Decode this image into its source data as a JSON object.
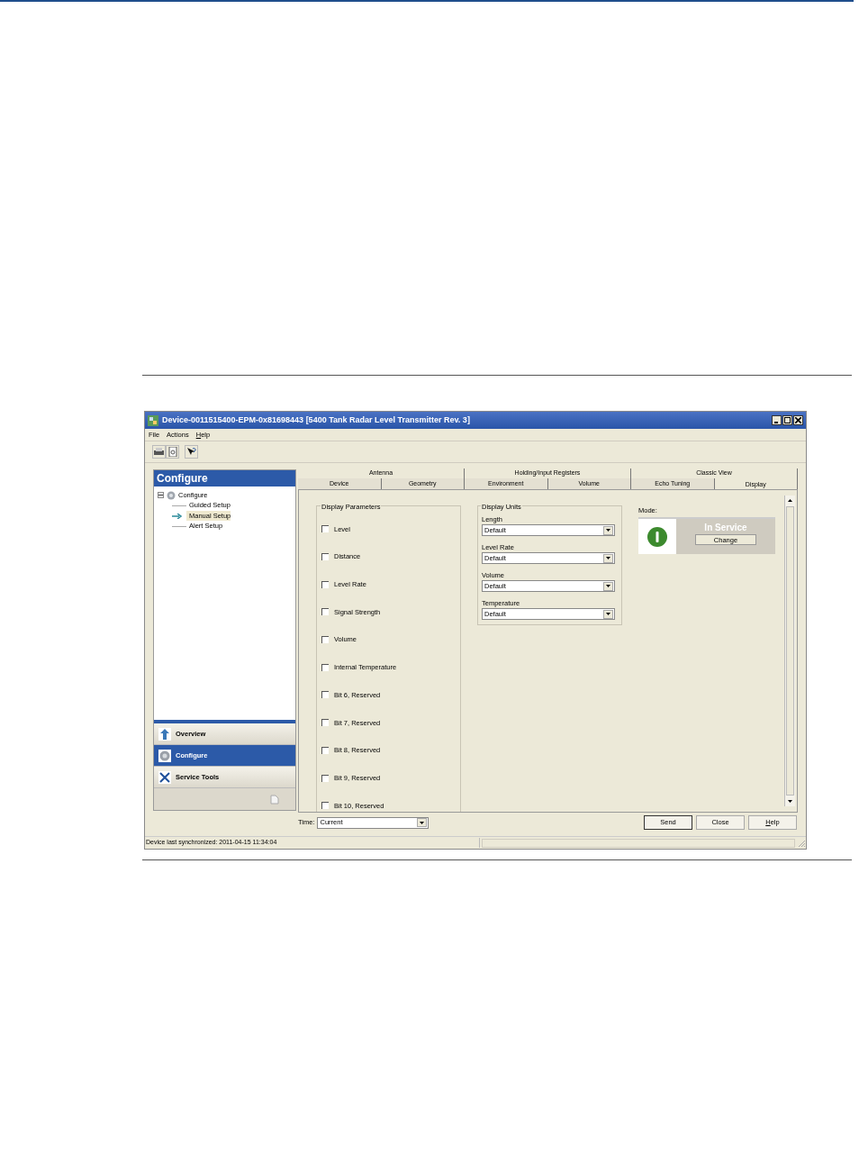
{
  "window": {
    "title": "Device-0011515400-EPM-0x81698443 [5400 Tank Radar Level Transmitter Rev. 3]"
  },
  "menu": [
    {
      "label": "File",
      "mnemonic": false
    },
    {
      "label": "Actions",
      "mnemonic": false
    },
    {
      "label": "Help",
      "mnemonic": true
    }
  ],
  "sidebar": {
    "header": "Configure",
    "tree": [
      {
        "label": "Configure",
        "expanded": true,
        "selected": false,
        "children": [
          {
            "label": "Guided Setup",
            "selected": false
          },
          {
            "label": "Manual Setup",
            "selected": true
          },
          {
            "label": "Alert Setup",
            "selected": false
          }
        ]
      }
    ],
    "nav": [
      {
        "label": "Overview",
        "kind": "overview",
        "selected": false
      },
      {
        "label": "Configure",
        "kind": "configure",
        "selected": true
      },
      {
        "label": "Service Tools",
        "kind": "tools",
        "selected": false
      }
    ]
  },
  "tabs_back": [
    {
      "label": "Antenna",
      "selected": false
    },
    {
      "label": "Holding/Input Registers",
      "selected": false
    },
    {
      "label": "Classic View",
      "selected": false
    }
  ],
  "tabs_front": [
    {
      "label": "Device",
      "selected": false
    },
    {
      "label": "Geometry",
      "selected": false
    },
    {
      "label": "Environment",
      "selected": false
    },
    {
      "label": "Volume",
      "selected": false
    },
    {
      "label": "Echo Tuning",
      "selected": false
    },
    {
      "label": "Display",
      "selected": true
    }
  ],
  "display_parameters": {
    "title": "Display Parameters",
    "items": [
      {
        "label": "Level",
        "checked": false
      },
      {
        "label": "Distance",
        "checked": false
      },
      {
        "label": "Level Rate",
        "checked": false
      },
      {
        "label": "Signal Strength",
        "checked": false
      },
      {
        "label": "Volume",
        "checked": false
      },
      {
        "label": "Internal Temperature",
        "checked": false
      },
      {
        "label": "Bit 6, Reserved",
        "checked": false
      },
      {
        "label": "Bit 7, Reserved",
        "checked": false
      },
      {
        "label": "Bit 8, Reserved",
        "checked": false
      },
      {
        "label": "Bit 9, Reserved",
        "checked": false
      },
      {
        "label": "Bit 10, Reserved",
        "checked": false
      }
    ]
  },
  "display_units": {
    "title": "Display Units",
    "fields": [
      {
        "label": "Length",
        "value": "Default"
      },
      {
        "label": "Level Rate",
        "value": "Default"
      },
      {
        "label": "Volume",
        "value": "Default"
      },
      {
        "label": "Temperature",
        "value": "Default"
      }
    ]
  },
  "mode": {
    "label": "Mode:",
    "status": "In Service",
    "button": "Change"
  },
  "time": {
    "label": "Time:",
    "value": "Current"
  },
  "buttons": [
    {
      "label": "Send",
      "mnemonic": false,
      "default": true
    },
    {
      "label": "Close",
      "mnemonic": false,
      "default": false
    },
    {
      "label": "Help",
      "mnemonic": true,
      "default": false
    }
  ],
  "status_bar": "Device last synchronized: 2011-04-15 11:34:04"
}
